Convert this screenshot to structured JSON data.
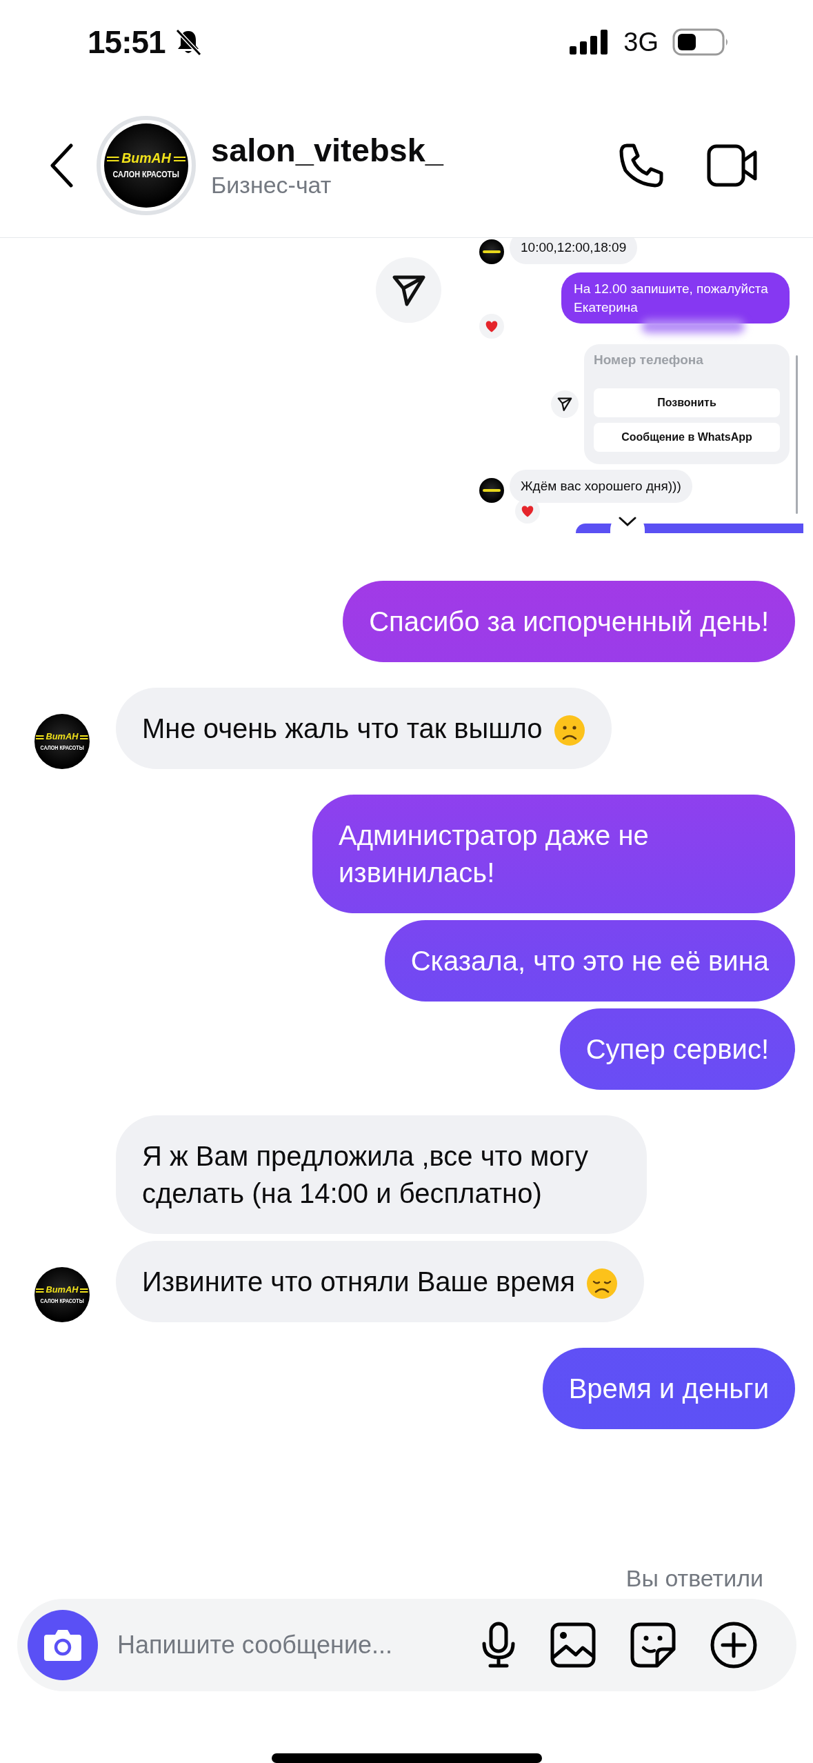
{
  "status_bar": {
    "time": "15:51",
    "network": "3G"
  },
  "header": {
    "username": "salon_vitebsk_",
    "subtitle": "Бизнес-чат",
    "avatar": {
      "brand": "ВитАН",
      "caption": "САЛОН КРАСОТЫ"
    }
  },
  "shared_screenshot": {
    "messages": [
      {
        "kind": "incoming",
        "text": "10:00,12:00,18:09",
        "reacted": false
      },
      {
        "kind": "outgoing",
        "text": "На 12.00 запишите, пожалуйста Екатерина",
        "reacted": true
      },
      {
        "kind": "card",
        "title": "Номер телефона",
        "buttons": [
          "Позвонить",
          "Сообщение в WhatsApp"
        ]
      },
      {
        "kind": "incoming",
        "text": "Ждём вас хорошего дня)))",
        "reacted": true
      }
    ]
  },
  "messages": [
    {
      "kind": "outgoing",
      "text": "Спасибо за испорченный день!"
    },
    {
      "kind": "incoming",
      "parts": [
        {
          "kind": "text",
          "text": "Мне очень жаль что так вышло"
        },
        {
          "kind": "frown_face"
        }
      ],
      "avatar": {
        "brand": "ВитАН",
        "caption": "САЛОН КРАСОТЫ"
      }
    },
    {
      "kind": "outgoing",
      "text": "Администратор даже не извинилась!"
    },
    {
      "kind": "outgoing",
      "text": "Сказала, что это не её вина"
    },
    {
      "kind": "outgoing",
      "text": "Супер сервис!"
    },
    {
      "kind": "incoming",
      "text": "Я ж Вам предложила ,все что могу сделать (на 14:00 и бесплатно)"
    },
    {
      "kind": "incoming",
      "parts": [
        {
          "kind": "text",
          "text": "Извините что отняли Ваше время"
        },
        {
          "kind": "sad_face"
        }
      ],
      "avatar": {
        "brand": "ВитАН",
        "caption": "САЛОН КРАСОТЫ"
      }
    },
    {
      "kind": "outgoing",
      "text": "Время и деньги"
    }
  ],
  "reply_status": "Вы ответили",
  "composer": {
    "placeholder": "Напишите сообщение..."
  }
}
